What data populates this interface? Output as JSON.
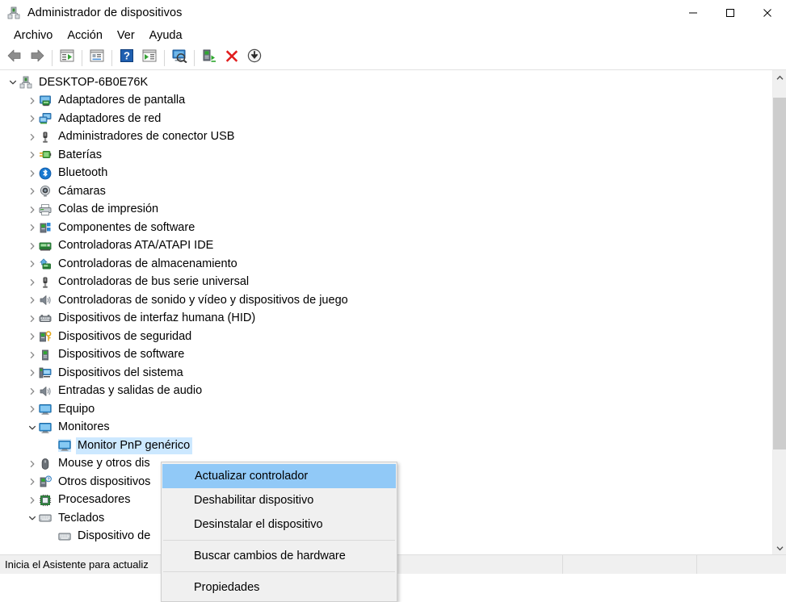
{
  "window": {
    "title": "Administrador de dispositivos",
    "title_icon": "device-manager-icon",
    "minimize_label": "—",
    "maximize_label": "□",
    "close_label": "✕"
  },
  "menubar": {
    "items": [
      {
        "label": "Archivo"
      },
      {
        "label": "Acción"
      },
      {
        "label": "Ver"
      },
      {
        "label": "Ayuda"
      }
    ]
  },
  "toolbar": {
    "buttons": [
      {
        "name": "back-icon",
        "tooltip": "Atrás"
      },
      {
        "name": "forward-icon",
        "tooltip": "Adelante"
      },
      {
        "name": "show-hide-console-tree-icon",
        "tooltip": "Mostrar/ocultar árbol de consola"
      },
      {
        "name": "properties-icon",
        "tooltip": "Propiedades"
      },
      {
        "name": "help-icon",
        "tooltip": "Ayuda"
      },
      {
        "name": "show-hide-action-pane-icon",
        "tooltip": "Mostrar/ocultar panel de acciones"
      },
      {
        "name": "scan-hardware-changes-icon",
        "tooltip": "Buscar cambios de hardware"
      },
      {
        "name": "update-driver-icon",
        "tooltip": "Actualizar controlador"
      },
      {
        "name": "uninstall-device-icon",
        "tooltip": "Desinstalar el dispositivo"
      },
      {
        "name": "disable-device-icon",
        "tooltip": "Deshabilitar dispositivo"
      }
    ]
  },
  "tree": {
    "nodes": [
      {
        "label": "DESKTOP-6B0E76K",
        "level": 0,
        "expander": "expanded",
        "icon": "computer-icon",
        "selected": false
      },
      {
        "label": "Adaptadores de pantalla",
        "level": 1,
        "expander": "collapsed",
        "icon": "display-adapter-icon",
        "selected": false
      },
      {
        "label": "Adaptadores de red",
        "level": 1,
        "expander": "collapsed",
        "icon": "network-adapter-icon",
        "selected": false
      },
      {
        "label": "Administradores de conector USB",
        "level": 1,
        "expander": "collapsed",
        "icon": "usb-connector-icon",
        "selected": false
      },
      {
        "label": "Baterías",
        "level": 1,
        "expander": "collapsed",
        "icon": "battery-icon",
        "selected": false
      },
      {
        "label": "Bluetooth",
        "level": 1,
        "expander": "collapsed",
        "icon": "bluetooth-icon",
        "selected": false
      },
      {
        "label": "Cámaras",
        "level": 1,
        "expander": "collapsed",
        "icon": "camera-icon",
        "selected": false
      },
      {
        "label": "Colas de impresión",
        "level": 1,
        "expander": "collapsed",
        "icon": "printer-icon",
        "selected": false
      },
      {
        "label": "Componentes de software",
        "level": 1,
        "expander": "collapsed",
        "icon": "software-component-icon",
        "selected": false
      },
      {
        "label": "Controladoras ATA/ATAPI IDE",
        "level": 1,
        "expander": "collapsed",
        "icon": "ide-controller-icon",
        "selected": false
      },
      {
        "label": "Controladoras de almacenamiento",
        "level": 1,
        "expander": "collapsed",
        "icon": "storage-controller-icon",
        "selected": false
      },
      {
        "label": "Controladoras de bus serie universal",
        "level": 1,
        "expander": "collapsed",
        "icon": "usb-controller-icon",
        "selected": false
      },
      {
        "label": "Controladoras de sonido y vídeo y dispositivos de juego",
        "level": 1,
        "expander": "collapsed",
        "icon": "sound-device-icon",
        "selected": false
      },
      {
        "label": "Dispositivos de interfaz humana (HID)",
        "level": 1,
        "expander": "collapsed",
        "icon": "hid-device-icon",
        "selected": false
      },
      {
        "label": "Dispositivos de seguridad",
        "level": 1,
        "expander": "collapsed",
        "icon": "security-device-icon",
        "selected": false
      },
      {
        "label": "Dispositivos de software",
        "level": 1,
        "expander": "collapsed",
        "icon": "software-device-icon",
        "selected": false
      },
      {
        "label": "Dispositivos del sistema",
        "level": 1,
        "expander": "collapsed",
        "icon": "system-device-icon",
        "selected": false
      },
      {
        "label": "Entradas y salidas de audio",
        "level": 1,
        "expander": "collapsed",
        "icon": "audio-io-icon",
        "selected": false
      },
      {
        "label": "Equipo",
        "level": 1,
        "expander": "collapsed",
        "icon": "computer-device-icon",
        "selected": false
      },
      {
        "label": "Monitores",
        "level": 1,
        "expander": "expanded",
        "icon": "monitor-icon",
        "selected": false
      },
      {
        "label": "Monitor PnP genérico",
        "level": 2,
        "expander": "none",
        "icon": "monitor-icon",
        "selected": true
      },
      {
        "label": "Mouse y otros dis",
        "level": 1,
        "expander": "collapsed",
        "icon": "mouse-icon",
        "selected": false
      },
      {
        "label": "Otros dispositivos",
        "level": 1,
        "expander": "collapsed",
        "icon": "unknown-device-icon",
        "selected": false
      },
      {
        "label": "Procesadores",
        "level": 1,
        "expander": "collapsed",
        "icon": "processor-icon",
        "selected": false
      },
      {
        "label": "Teclados",
        "level": 1,
        "expander": "expanded",
        "icon": "keyboard-icon",
        "selected": false
      },
      {
        "label": "Dispositivo de",
        "level": 2,
        "expander": "none",
        "icon": "keyboard-icon",
        "selected": false
      }
    ]
  },
  "scrollbar": {
    "up_arrow": "scroll-up-icon",
    "down_arrow": "scroll-down-icon",
    "thumb_top_pct": 3,
    "thumb_height_pct": 77
  },
  "context_menu": {
    "items": [
      {
        "label": "Actualizar controlador",
        "highlighted": true,
        "separator_after": false
      },
      {
        "label": "Deshabilitar dispositivo",
        "highlighted": false,
        "separator_after": false
      },
      {
        "label": "Desinstalar el dispositivo",
        "highlighted": false,
        "separator_after": true
      },
      {
        "label": "Buscar cambios de hardware",
        "highlighted": false,
        "separator_after": true
      },
      {
        "label": "Propiedades",
        "highlighted": false,
        "separator_after": false
      }
    ]
  },
  "statusbar": {
    "pane1": "Inicia el Asistente para actualiz",
    "pane2": "",
    "pane3": ""
  },
  "colors": {
    "selection_blue": "#cce8ff",
    "menu_highlight": "#91c9f7",
    "chrome_gray": "#f0f0f0"
  }
}
